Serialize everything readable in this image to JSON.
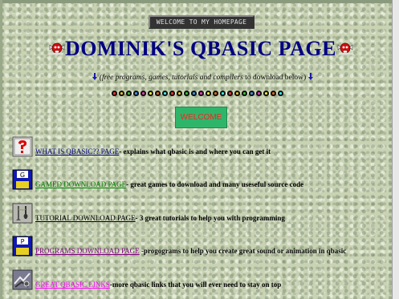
{
  "header": {
    "banner_text": "WELCOME TO MY HOMEPAGE",
    "title": "DOMINIK'S QBASIC PAGE",
    "subtitle_italic": "(free programs, games, tutorials and compilers",
    "subtitle_plain": " to download below)"
  },
  "welcome_button": {
    "label": "WELCOME",
    "bg_color": "#2fb56a",
    "text_color": "#ff2020"
  },
  "separator_dot_colors": [
    "#ff3333",
    "#ffcc00",
    "#33cc33",
    "#3399ff",
    "#ff33cc",
    "#ffff33",
    "#ff6600",
    "#33ffff",
    "#ff3333",
    "#ffcc00",
    "#33cc33",
    "#3399ff",
    "#ff33cc",
    "#ffff33",
    "#ff6600",
    "#33ffff",
    "#ff3333",
    "#ffcc00",
    "#33cc33",
    "#3399ff",
    "#ff33cc",
    "#ffff33",
    "#ff6600",
    "#33ffff"
  ],
  "links": [
    {
      "label": "WHAT IS QBASIC?? PAGE",
      "desc": "- explains what qbasic is and where you can get it",
      "color": "#000080",
      "icon": "question-mark-icon"
    },
    {
      "label": "GAMED DOWNLOAD PAGE",
      "desc": "- great games to download and many useseful source code",
      "color": "#008000",
      "icon": "game-floppy-icon"
    },
    {
      "label": "TUTORIAL DOWNLOAD PAGE",
      "desc": "- 3 great tutorials to help you with programming",
      "color": "#000000",
      "icon": "tools-icon"
    },
    {
      "label": "PROGRAMS DOWNLOAD PAGE",
      "desc": " -progograms to help you create great sound or animation in qbasic",
      "color": "#800080",
      "icon": "program-floppy-icon"
    },
    {
      "label": "GREAT QBASIC LINKS",
      "desc": "-more qbasic links that you will ever need to stay on top",
      "color": "#ff00ff",
      "icon": "links-icon"
    }
  ]
}
